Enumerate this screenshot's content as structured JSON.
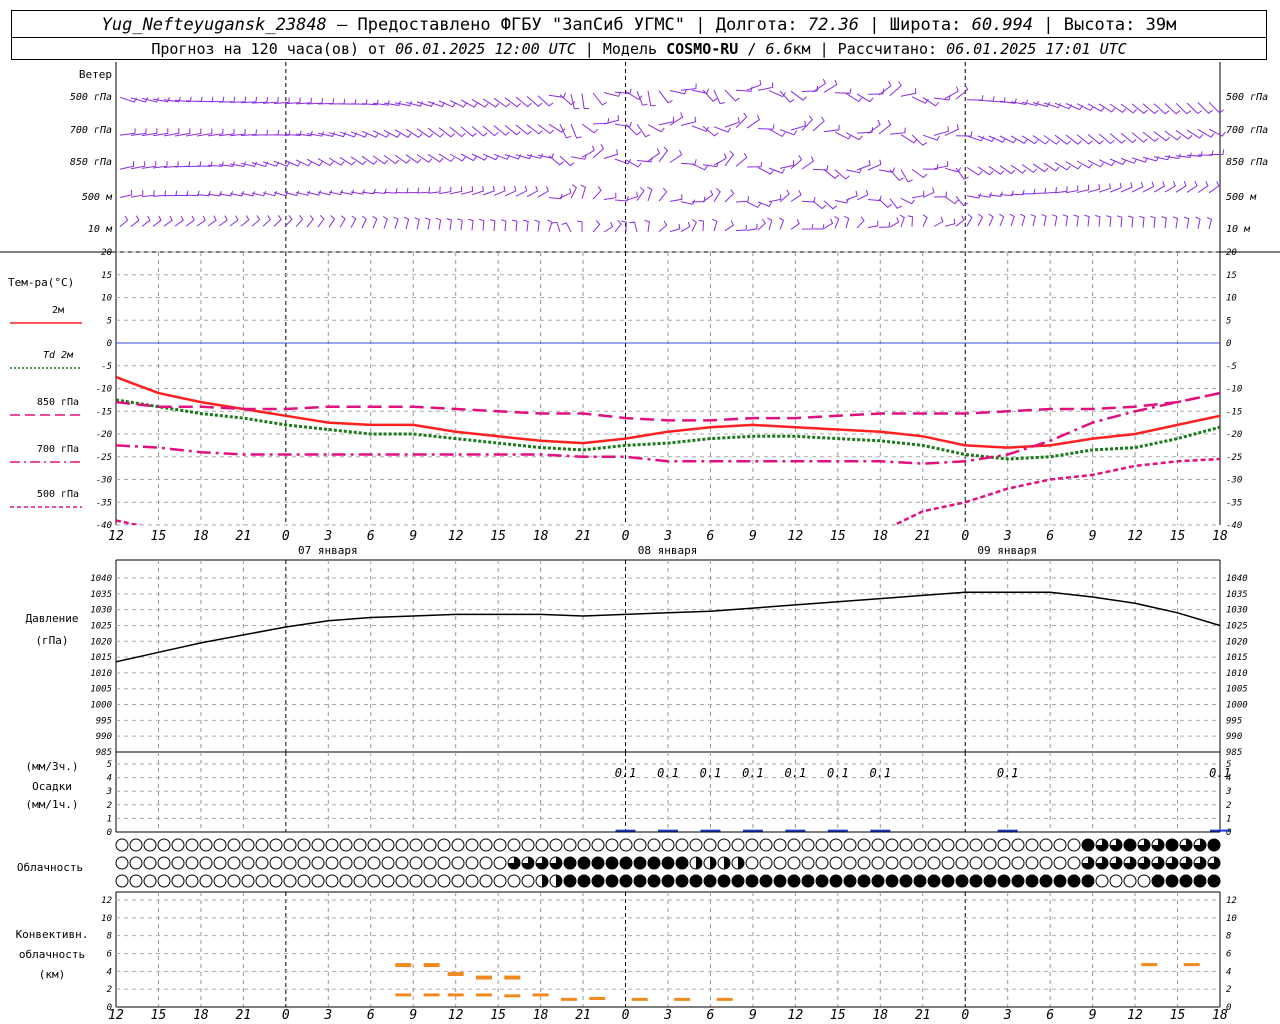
{
  "header": {
    "station": "Yug_Nefteyugansk_23848",
    "dash1": " – Предоставлено ФГБУ \"ЗапСиб УГМС\" | Долгота: ",
    "lon": "72.36",
    "sep_lat": " | Широта: ",
    "lat": "60.994",
    "sep_alt": " | Высота: ",
    "alt": "39м",
    "fc_prefix": "Прогноз на 120 часа(ов) от ",
    "fc_time": "06.01.2025 12:00 UTC",
    "model_prefix": "  | Модель ",
    "model": "COSMO-RU",
    "model_res_sep": " / ",
    "model_res": "6.6",
    "model_res_unit": "км",
    "calc_prefix": " | Рассчитано: ",
    "calc_time": "06.01.2025 17:01 UTC"
  },
  "wind": {
    "title": "Ветер",
    "levels": [
      "500 гПа",
      "700 гПа",
      "850 гПа",
      "500 м",
      "10  м"
    ],
    "right_levels": [
      "500 гПа",
      "700 гПа",
      "850 гПа",
      "500 м",
      "10  м"
    ]
  },
  "temperature": {
    "title": "Тем-ра(°С)",
    "legend": [
      {
        "label": "2м",
        "color": "#ff2020",
        "style": "solid"
      },
      {
        "label": "Td 2м",
        "color": "#1a7a1a",
        "style": "dot"
      },
      {
        "label": "850 гПа",
        "color": "#e01080",
        "style": "dash"
      },
      {
        "label": "700 гПа",
        "color": "#e01080",
        "style": "dashdot"
      },
      {
        "label": "500 гПа",
        "color": "#e01080",
        "style": "shortdash"
      }
    ],
    "ticks": [
      "20",
      "15",
      "10",
      "5",
      "0",
      "-5",
      "-10",
      "-15",
      "-20",
      "-25",
      "-30",
      "-35",
      "-40"
    ]
  },
  "time_axis": {
    "hours": [
      "12",
      "15",
      "18",
      "21",
      "0",
      "3",
      "6",
      "9",
      "12",
      "15",
      "18",
      "21",
      "0",
      "3",
      "6",
      "9",
      "12",
      "15",
      "18",
      "21",
      "0",
      "3",
      "6",
      "9",
      "12",
      "15",
      "18"
    ],
    "dates": [
      "07 января",
      "08 января",
      "09 января"
    ]
  },
  "pressure": {
    "title": "Давление",
    "unit": "(гПа)",
    "ticks": [
      "1040",
      "1035",
      "1030",
      "1025",
      "1020",
      "1015",
      "1010",
      "1005",
      "1000",
      "995",
      "990",
      "985"
    ]
  },
  "precip": {
    "unit1": "(мм/3ч.)",
    "title": "Осадки",
    "unit2": "(мм/1ч.)",
    "ticks": [
      "5",
      "4",
      "3",
      "2",
      "1",
      "0"
    ],
    "labels": [
      "0.1",
      "0.1",
      "0.1",
      "0.1",
      "0.1",
      "0.1",
      "0.1",
      "0.1",
      "0.1"
    ]
  },
  "cloud": {
    "title": "Облачность"
  },
  "convective": {
    "title1": "Конвективн.",
    "title2": "облачность",
    "unit": "(км)",
    "ticks": [
      "12",
      "10",
      "8",
      "6",
      "4",
      "2",
      "0"
    ]
  },
  "colors": {
    "wind": "#8a2be2",
    "t2m": "#ff2020",
    "td": "#1a7a1a",
    "upper": "#e01080",
    "zero": "#3050d0",
    "precip": "#1a3ad0",
    "conv": "#f08a20"
  },
  "chart_data": [
    {
      "type": "line",
      "title": "Тем-ра(°С)",
      "x": [
        "12",
        "15",
        "18",
        "21",
        "0",
        "3",
        "6",
        "9",
        "12",
        "15",
        "18",
        "21",
        "0",
        "3",
        "6",
        "9",
        "12",
        "15",
        "18",
        "21",
        "0",
        "3",
        "6",
        "9",
        "12",
        "15",
        "18"
      ],
      "ylim": [
        -40,
        20
      ],
      "series": [
        {
          "name": "2м",
          "values": [
            -7.5,
            -11,
            -13,
            -14.5,
            -16,
            -17.5,
            -18,
            -18,
            -19.5,
            -20.5,
            -21.5,
            -22,
            -21,
            -19.5,
            -18.5,
            -18,
            -18.5,
            -19,
            -19.5,
            -20.5,
            -22.5,
            -23,
            -22.5,
            -21,
            -20,
            -18,
            -16
          ]
        },
        {
          "name": "Td 2м",
          "values": [
            -12.5,
            -14,
            -15.5,
            -16.5,
            -18,
            -19,
            -20,
            -20,
            -21,
            -22,
            -23,
            -23.5,
            -22.5,
            -22,
            -21,
            -20.5,
            -20.5,
            -21,
            -21.5,
            -22.5,
            -24.5,
            -25.5,
            -25,
            -23.5,
            -23,
            -21,
            -18.5
          ]
        },
        {
          "name": "850 гПа",
          "values": [
            -13,
            -14,
            -14,
            -14.5,
            -14.5,
            -14,
            -14,
            -14,
            -14.5,
            -15,
            -15.5,
            -15.5,
            -16.5,
            -17,
            -17,
            -16.5,
            -16.5,
            -16,
            -15.5,
            -15.5,
            -15.5,
            -15,
            -14.5,
            -14.5,
            -14,
            -13,
            -11
          ]
        },
        {
          "name": "700 гПа",
          "values": [
            -22.5,
            -23,
            -24,
            -24.5,
            -24.5,
            -24.5,
            -24.5,
            -24.5,
            -24.5,
            -24.5,
            -24.5,
            -25,
            -25,
            -26,
            -26,
            -26,
            -26,
            -26,
            -26,
            -26.5,
            -26,
            -24.5,
            -21.5,
            -17.5,
            -15,
            -13,
            -11
          ]
        },
        {
          "name": "500 гПа",
          "values": [
            -39,
            -41,
            -42,
            -42,
            -42,
            -42,
            -42,
            -42,
            -42,
            -42,
            -42,
            -42,
            -42,
            -42,
            -42,
            -42,
            -42,
            -42,
            -41.5,
            -37,
            -35,
            -32,
            -30,
            -29,
            -27,
            -26,
            -25.5
          ]
        }
      ]
    },
    {
      "type": "line",
      "title": "Давление",
      "x": [
        "12",
        "15",
        "18",
        "21",
        "0",
        "3",
        "6",
        "9",
        "12",
        "15",
        "18",
        "21",
        "0",
        "3",
        "6",
        "9",
        "12",
        "15",
        "18",
        "21",
        "0",
        "3",
        "6",
        "9",
        "12",
        "15",
        "18"
      ],
      "ylim": [
        985,
        1040
      ],
      "series": [
        {
          "name": "Давление",
          "values": [
            1013.5,
            1016.5,
            1019.5,
            1022,
            1024.5,
            1026.5,
            1027.5,
            1028,
            1028.5,
            1028.5,
            1028.5,
            1028,
            1028.5,
            1029,
            1029.5,
            1030.5,
            1031.5,
            1032.5,
            1033.5,
            1034.5,
            1035.5,
            1035.5,
            1035.5,
            1034,
            1032,
            1029,
            1025
          ]
        }
      ]
    },
    {
      "type": "bar",
      "title": "Осадки",
      "x": [
        "12",
        "15",
        "18",
        "21",
        "0",
        "3",
        "6",
        "9",
        "12",
        "15",
        "18",
        "21",
        "0",
        "3",
        "6",
        "9",
        "12",
        "15",
        "18",
        "21",
        "0",
        "3",
        "6",
        "9",
        "12",
        "15",
        "18"
      ],
      "ylim": [
        0,
        5
      ],
      "values": [
        0,
        0,
        0,
        0,
        0,
        0,
        0,
        0,
        0,
        0,
        0,
        0,
        0.1,
        0.1,
        0.1,
        0.1,
        0.1,
        0.1,
        0.1,
        0,
        0,
        0.1,
        0,
        0,
        0,
        0,
        0.1
      ]
    },
    {
      "type": "bar",
      "title": "Конвективн. облачность",
      "x": [
        "12",
        "15",
        "18",
        "21",
        "0",
        "3",
        "6",
        "9",
        "12",
        "15",
        "18",
        "21",
        "0",
        "3",
        "6",
        "9",
        "12",
        "15",
        "18",
        "21",
        "0",
        "3",
        "6",
        "9",
        "12",
        "15",
        "18"
      ],
      "ylim": [
        0,
        12
      ],
      "segments": [
        {
          "hour": 20.3,
          "base": 1.3,
          "top": 4.7
        },
        {
          "hour": 22.3,
          "base": 1.3,
          "top": 4.7
        },
        {
          "hour": 24,
          "base": 1.3,
          "top": 3.7
        },
        {
          "hour": 26,
          "base": 1.3,
          "top": 3.3
        },
        {
          "hour": 28,
          "base": 1.2,
          "top": 3.3
        },
        {
          "hour": 30,
          "base": 1.3,
          "top": 1.3
        },
        {
          "hour": 32,
          "base": 0.8,
          "top": 0.8
        },
        {
          "hour": 34,
          "base": 0.9,
          "top": 0.9
        },
        {
          "hour": 37,
          "base": 0.8,
          "top": 0.8
        },
        {
          "hour": 40,
          "base": 0.8,
          "top": 0.8
        },
        {
          "hour": 43,
          "base": 0.8,
          "top": 0.8
        },
        {
          "hour": 73,
          "base": 4.7,
          "top": 4.7
        },
        {
          "hour": 76,
          "base": 4.7,
          "top": 4.7
        }
      ]
    }
  ]
}
